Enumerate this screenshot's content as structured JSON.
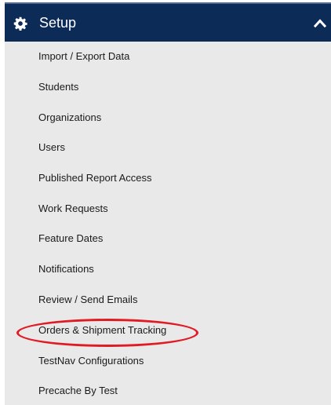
{
  "panel": {
    "title": "Setup",
    "icon": "gear-icon",
    "toggle_icon": "chevron-up-icon",
    "header_color": "#0d2b57"
  },
  "menu": {
    "items": [
      {
        "label": "Import / Export Data"
      },
      {
        "label": "Students"
      },
      {
        "label": "Organizations"
      },
      {
        "label": "Users"
      },
      {
        "label": "Published Report Access"
      },
      {
        "label": "Work Requests"
      },
      {
        "label": "Feature Dates"
      },
      {
        "label": "Notifications"
      },
      {
        "label": "Review / Send Emails"
      },
      {
        "label": "Orders & Shipment Tracking",
        "highlighted": true
      },
      {
        "label": "TestNav Configurations"
      },
      {
        "label": "Precache By Test"
      }
    ]
  },
  "annotation": {
    "type": "ellipse",
    "color": "#e01b24",
    "target": "Orders & Shipment Tracking"
  }
}
